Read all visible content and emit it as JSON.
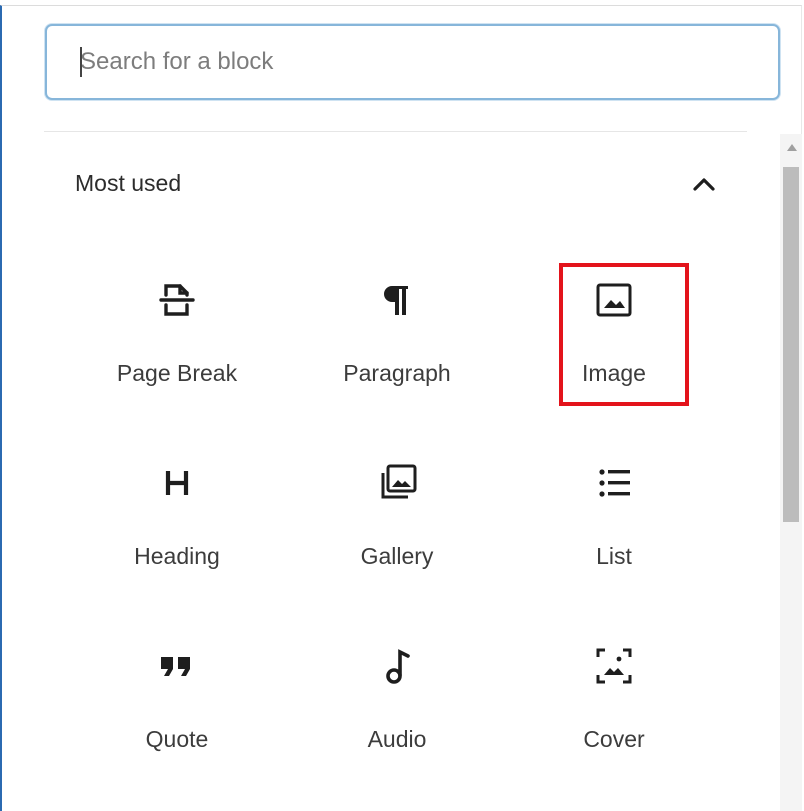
{
  "search": {
    "placeholder": "Search for a block",
    "value": ""
  },
  "section": {
    "title": "Most used",
    "collapse_icon": "chevron-up-icon"
  },
  "blocks": [
    {
      "label": "Page Break",
      "icon": "page-break-icon"
    },
    {
      "label": "Paragraph",
      "icon": "paragraph-icon"
    },
    {
      "label": "Image",
      "icon": "image-icon"
    },
    {
      "label": "Heading",
      "icon": "heading-icon"
    },
    {
      "label": "Gallery",
      "icon": "gallery-icon"
    },
    {
      "label": "List",
      "icon": "list-icon"
    },
    {
      "label": "Quote",
      "icon": "quote-icon"
    },
    {
      "label": "Audio",
      "icon": "audio-icon"
    },
    {
      "label": "Cover",
      "icon": "cover-icon"
    }
  ],
  "highlight": {
    "color": "#e3131b",
    "target": "Image"
  },
  "colors": {
    "accent": "#2b6ab1",
    "search_border": "#87b6da",
    "icon": "#1e1e1e"
  }
}
